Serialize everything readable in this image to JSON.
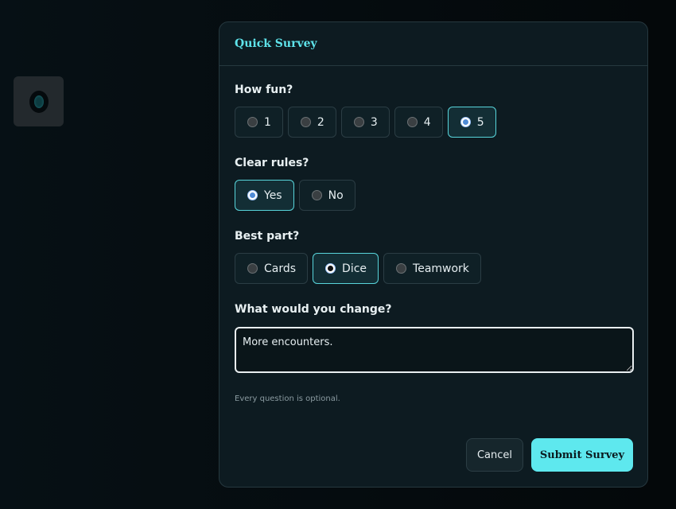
{
  "modal": {
    "title": "Quick Survey",
    "hint": "Every question is optional.",
    "cancel_label": "Cancel",
    "submit_label": "Submit Survey"
  },
  "questions": {
    "fun": {
      "label": "How fun?",
      "options": [
        "1",
        "2",
        "3",
        "4",
        "5"
      ],
      "selected": "5"
    },
    "rules": {
      "label": "Clear rules?",
      "options": [
        "Yes",
        "No"
      ],
      "selected": "Yes"
    },
    "best": {
      "label": "Best part?",
      "options": [
        "Cards",
        "Dice",
        "Teamwork"
      ],
      "selected": "Dice"
    },
    "change": {
      "label": "What would you change?",
      "value": "More encounters."
    }
  },
  "colors": {
    "accent": "#5ee8ee",
    "selected_border": "#58d5db",
    "modal_bg": "#0d1b21"
  },
  "icons": {
    "side_widget": "eye-icon"
  }
}
